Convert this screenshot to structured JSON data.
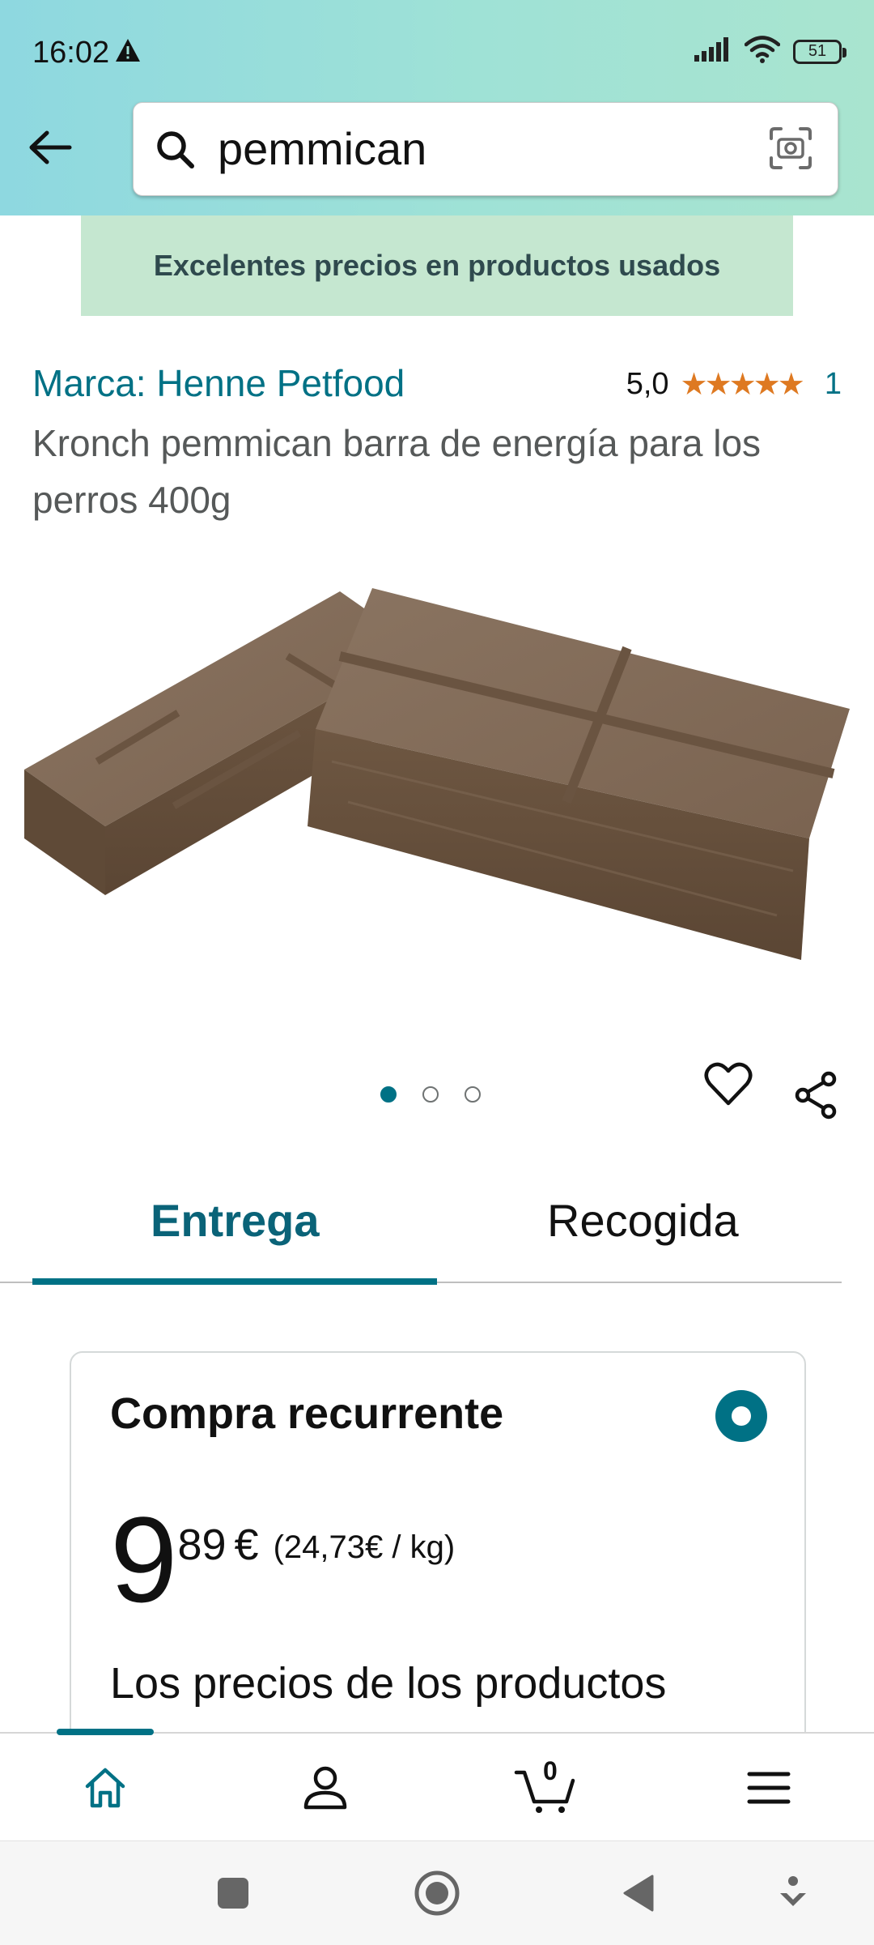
{
  "status_bar": {
    "time": "16:02",
    "battery": "51"
  },
  "search": {
    "query": "pemmican"
  },
  "banner": {
    "text": "Excelentes precios en productos usados"
  },
  "product": {
    "brand": "Marca: Henne Petfood",
    "rating_value": "5,0",
    "stars": "★★★★★",
    "rating_count": "1",
    "title": "Kronch pemmican barra de energía para los perros 400g",
    "image_count": 3,
    "active_image": 1
  },
  "tabs": [
    {
      "label": "Entrega",
      "selected": true
    },
    {
      "label": "Recogida",
      "selected": false
    }
  ],
  "purchase_card": {
    "title": "Compra recurrente",
    "price_whole": "9",
    "price_fraction": "89",
    "currency": "€",
    "unit_price": "(24,73€ / kg)",
    "note": "Los precios de los productos"
  },
  "bottom_nav": {
    "cart_count": "0"
  },
  "colors": {
    "accent": "#007185",
    "star": "#de7921",
    "banner_bg": "#c5e7d0",
    "header_start": "#8ed8e0",
    "header_end": "#a9e4cf"
  }
}
